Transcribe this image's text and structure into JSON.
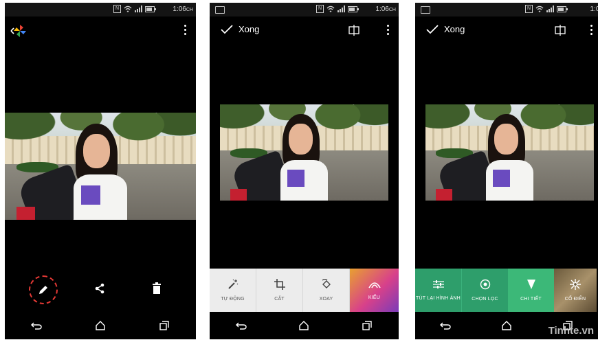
{
  "status_bar": {
    "time": "1:06",
    "time_suffix": "CH",
    "nfc": "N"
  },
  "screen1": {
    "bottom_actions": [
      "edit",
      "share",
      "delete"
    ]
  },
  "screen2": {
    "done_label": "Xong",
    "tools": [
      {
        "label": "TỰ ĐỘNG",
        "icon": "magic-wand-icon"
      },
      {
        "label": "CẮT",
        "icon": "crop-icon"
      },
      {
        "label": "XOAY",
        "icon": "rotate-icon"
      },
      {
        "label": "KIỂU",
        "icon": "rainbow-icon"
      }
    ]
  },
  "screen3": {
    "done_label": "Xong",
    "tools": [
      {
        "label": "TÚT LẠI HÌNH ẢNH",
        "icon": "sliders-icon"
      },
      {
        "label": "CHỌN LỌC",
        "icon": "target-icon"
      },
      {
        "label": "CHI TIẾT",
        "icon": "triangle-icon"
      },
      {
        "label": "CỔ ĐIỂN",
        "icon": "sparkle-icon"
      }
    ]
  },
  "watermark": "Tinhte.vn",
  "colors": {
    "edit_highlight": "#e53935",
    "tool_green": "#2e9e6b",
    "tool_active": "#3cb878",
    "accent_orange": "#f19a2e"
  }
}
